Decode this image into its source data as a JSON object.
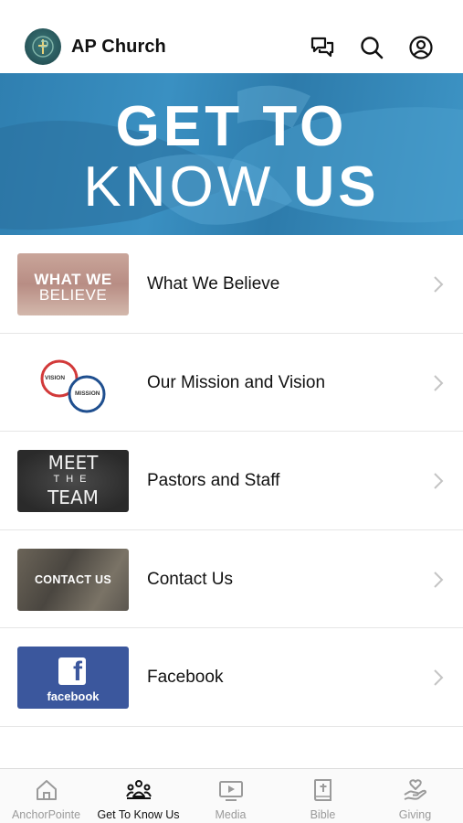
{
  "header": {
    "title": "AP Church",
    "icons": [
      "chat-icon",
      "search-icon",
      "profile-icon"
    ]
  },
  "banner": {
    "line1": "GET TO",
    "line2_light": "KNOW ",
    "line2_bold": "US",
    "color": "#2f7fb0"
  },
  "list": {
    "items": [
      {
        "label": "What We Believe",
        "thumb_line1": "WHAT WE",
        "thumb_line2": "BELIEVE"
      },
      {
        "label": "Our Mission and Vision",
        "thumb_line1": "VISION",
        "thumb_line2": "MISSION"
      },
      {
        "label": "Pastors and Staff",
        "thumb_line1": "MEET",
        "thumb_line2": "THE",
        "thumb_line3": "TEAM"
      },
      {
        "label": "Contact Us",
        "thumb_line1": "CONTACT US"
      },
      {
        "label": "Facebook",
        "thumb_line1": "f",
        "thumb_line2": "facebook"
      }
    ]
  },
  "tabbar": {
    "tabs": [
      {
        "label": "AnchorPointe",
        "icon": "home-icon",
        "active": false
      },
      {
        "label": "Get To Know Us",
        "icon": "people-icon",
        "active": true
      },
      {
        "label": "Media",
        "icon": "media-icon",
        "active": false
      },
      {
        "label": "Bible",
        "icon": "bible-icon",
        "active": false
      },
      {
        "label": "Giving",
        "icon": "giving-icon",
        "active": false
      }
    ]
  },
  "colors": {
    "accent": "#111111",
    "inactive": "#9a9a9a",
    "facebook": "#3b579d",
    "mission_ring_red": "#d23a3a",
    "mission_ring_blue": "#1f4f8f"
  }
}
